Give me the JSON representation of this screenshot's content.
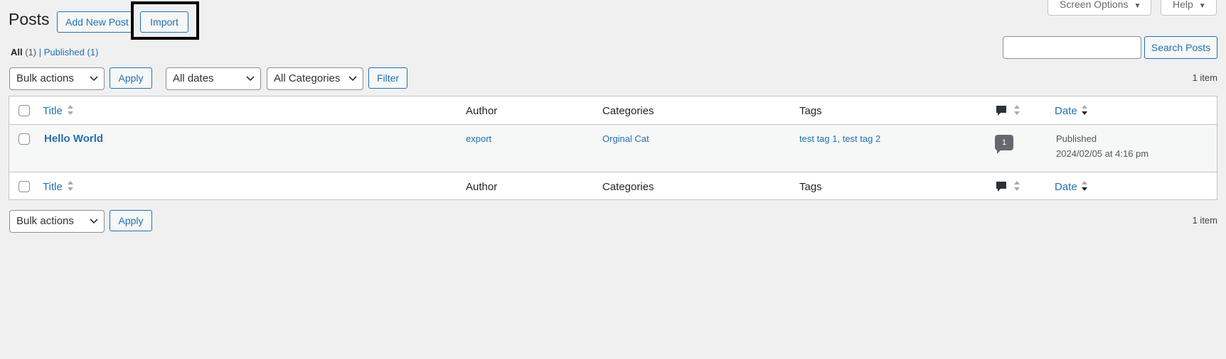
{
  "header": {
    "title": "Posts",
    "add_new_label": "Add New Post",
    "import_label": "Import",
    "screen_options_label": "Screen Options",
    "help_label": "Help"
  },
  "filters": {
    "all_label": "All",
    "all_count": "(1)",
    "separator": "|",
    "published_label": "Published",
    "published_count": "(1)"
  },
  "search": {
    "value": "",
    "button_label": "Search Posts"
  },
  "tablenav_top": {
    "bulk_actions": "Bulk actions",
    "apply_label": "Apply",
    "dates": "All dates",
    "categories": "All Categories",
    "filter_label": "Filter",
    "item_count": "1 item"
  },
  "table": {
    "columns": {
      "title": "Title",
      "author": "Author",
      "categories": "Categories",
      "tags": "Tags",
      "date": "Date"
    },
    "rows": [
      {
        "title": "Hello World",
        "author": "export",
        "category": "Orginal Cat",
        "tags": "test tag 1, test tag 2",
        "comments": "1",
        "status": "Published",
        "date": "2024/02/05 at 4:16 pm"
      }
    ]
  },
  "tablenav_bottom": {
    "bulk_actions": "Bulk actions",
    "apply_label": "Apply",
    "item_count": "1 item"
  },
  "colors": {
    "accent": "#2271b1",
    "background": "#f0f0f1",
    "highlight_border": "#000000"
  },
  "icons": [
    "comment-bubble-icon",
    "sort-arrows-icon",
    "chevron-down-icon",
    "triangle-down-icon"
  ]
}
